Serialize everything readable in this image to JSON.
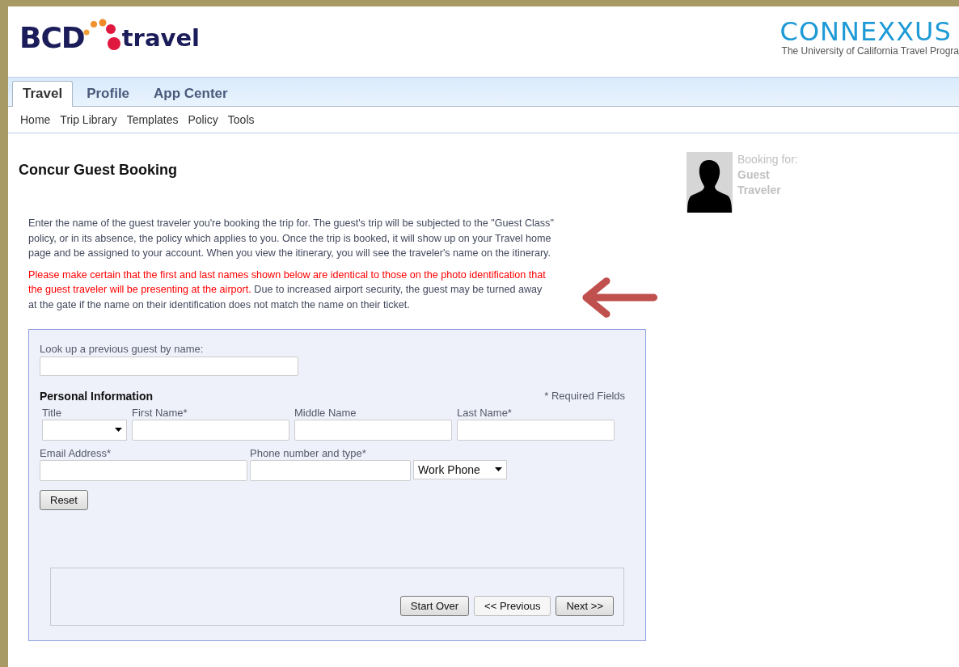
{
  "header": {
    "brand": {
      "name": "BCD",
      "suffix": "travel"
    },
    "partner": {
      "name": "CONNEXXUS",
      "tagline": "The University of California Travel Progra"
    }
  },
  "tabs": [
    {
      "label": "Travel",
      "selected": true
    },
    {
      "label": "Profile",
      "selected": false
    },
    {
      "label": "App Center",
      "selected": false
    }
  ],
  "subnav": [
    "Home",
    "Trip Library",
    "Templates",
    "Policy",
    "Tools"
  ],
  "page_title": "Concur Guest Booking",
  "booking_for": {
    "label": "Booking for:",
    "name_lines": [
      "Guest",
      "Traveler"
    ]
  },
  "intro": "Enter the name of the guest traveler you're booking the trip for. The guest's trip will be subjected to the \"Guest Class\" policy, or in its absence, the policy which applies to you. Once the trip is booked, it will show up on your Travel home page and be assigned to your account. When you view the itinerary, you will see the traveler's name on the itinerary.",
  "warning": {
    "alert": "Please make certain that the first and last names shown below are identical to those on the photo identification that the guest traveler will be presenting at the airport.",
    "note": "Due to increased airport security, the guest may be turned away at the gate if the name on their identification does not match the name on their ticket."
  },
  "form": {
    "lookup_label": "Look up a previous guest by name:",
    "section": "Personal Information",
    "required_note": "* Required Fields",
    "name_fields": [
      {
        "label": "Title",
        "kind": "select"
      },
      {
        "label": "First Name*",
        "kind": "text"
      },
      {
        "label": "Middle Name",
        "kind": "text"
      },
      {
        "label": "Last Name*",
        "kind": "text"
      }
    ],
    "email_label": "Email Address*",
    "phone_label": "Phone number and type*",
    "phone_type": "Work Phone",
    "reset": "Reset"
  },
  "nav_buttons": [
    {
      "label": "Start Over",
      "disabled": false
    },
    {
      "label": "<< Previous",
      "disabled": true
    },
    {
      "label": "Next >>",
      "disabled": false
    }
  ]
}
